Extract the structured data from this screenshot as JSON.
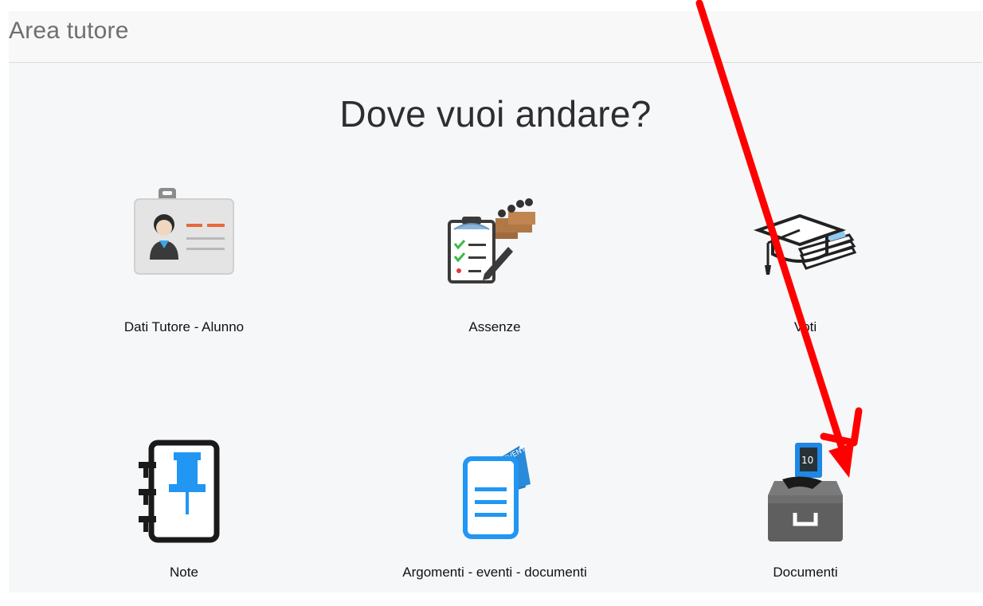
{
  "header": {
    "title": "Area tutore"
  },
  "main": {
    "heading": "Dove vuoi andare?",
    "tiles": [
      {
        "label": "Dati Tutore - Alunno",
        "icon": "id-card-icon"
      },
      {
        "label": "Assenze",
        "icon": "attendance-clipboard-icon"
      },
      {
        "label": "Voti",
        "icon": "graduation-cap-icon"
      },
      {
        "label": "Note",
        "icon": "notebook-pushpin-icon"
      },
      {
        "label": "Argomenti - eventi - documenti",
        "icon": "event-document-icon"
      },
      {
        "label": "Documenti",
        "icon": "document-archive-icon"
      }
    ]
  },
  "annotation": {
    "icon": "red-arrow-icon",
    "color": "#ff0000"
  },
  "colors": {
    "accent_blue": "#2196f3",
    "accent_orange": "#e8693a",
    "arrow_red": "#ff0000"
  }
}
